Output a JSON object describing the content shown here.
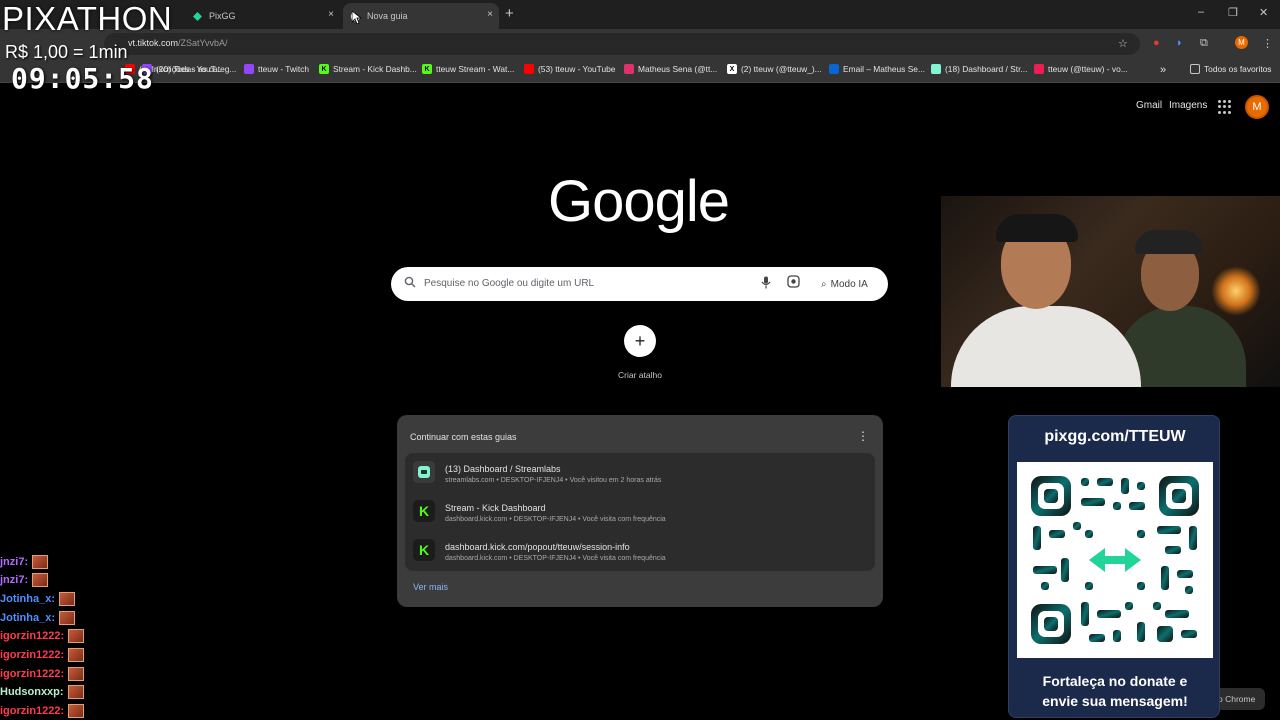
{
  "overlay": {
    "title": "PIXATHON",
    "rate": "R$ 1,00 = 1min",
    "timer": "09:05:58"
  },
  "tabs": [
    {
      "label": "PixGG",
      "active": false,
      "icon": "pixgg-icon",
      "close": "×"
    },
    {
      "label": "Nova guia",
      "active": true,
      "icon": "loading-icon",
      "close": "×"
    }
  ],
  "new_tab_symbol": "+",
  "window_controls": {
    "minimize": "–",
    "restore": "❐",
    "close": "✕"
  },
  "address_bar": {
    "url_host": "vt.tiktok.com",
    "url_path": "/ZSatYvvbA/"
  },
  "bookmarks": {
    "items": [
      {
        "label": "(6) Inscrições - YouT...",
        "icon": "youtube-icon",
        "color": "#ff0000"
      },
      {
        "label": "(20) Todas as categ...",
        "icon": "twitch-icon",
        "color": "#9146ff"
      },
      {
        "label": "tteuw - Twitch",
        "icon": "twitch-icon",
        "color": "#9146ff"
      },
      {
        "label": "Stream - Kick Dashb...",
        "icon": "kick-icon",
        "color": "#53fc18"
      },
      {
        "label": "tteuw Stream - Wat...",
        "icon": "kick-icon",
        "color": "#53fc18"
      },
      {
        "label": "(53) tteuw - YouTube",
        "icon": "youtube-icon",
        "color": "#ff0000"
      },
      {
        "label": "Matheus Sena (@tt...",
        "icon": "instagram-icon",
        "color": "#e1306c"
      },
      {
        "label": "(2) tteuw (@tteuw_)...",
        "icon": "x-icon",
        "color": "#ffffff"
      },
      {
        "label": "Email – Matheus Se...",
        "icon": "outlook-icon",
        "color": "#0a64d6"
      },
      {
        "label": "(18) Dashboard / Str...",
        "icon": "streamlabs-icon",
        "color": "#80f5d2"
      },
      {
        "label": "tteuw (@tteuw) - vo...",
        "icon": "tiktok-icon",
        "color": "#ee1d52"
      }
    ],
    "overflow": "»",
    "all_favorites": "Todos os favoritos"
  },
  "ntp": {
    "gmail": "Gmail",
    "images": "Imagens",
    "avatar_letter": "M",
    "logo": "Google",
    "search_placeholder": "Pesquise no Google ou digite um URL",
    "ai_mode": "Modo IA",
    "shortcut_symbol": "+",
    "shortcut_label": "Criar atalho"
  },
  "continue_card": {
    "title": "Continuar com estas guias",
    "items": [
      {
        "title": "(13) Dashboard / Streamlabs",
        "subtitle": "streamlabs.com • DESKTOP-IFJENJ4 • Você visitou em 2 horas atrás",
        "icon": "streamlabs-icon",
        "color": "#80f5d2"
      },
      {
        "title": "Stream - Kick Dashboard",
        "subtitle": "dashboard.kick.com • DESKTOP-IFJENJ4 • Você visita com frequência",
        "icon": "kick-icon",
        "color": "#53fc18"
      },
      {
        "title": "dashboard.kick.com/popout/tteuw/session-info",
        "subtitle": "dashboard.kick.com • DESKTOP-IFJENJ4 • Você visita com frequência",
        "icon": "kick-icon",
        "color": "#53fc18"
      }
    ],
    "see_more": "Ver mais"
  },
  "customize_button": "o Chrome",
  "donation": {
    "url": "pixgg.com/TTEUW",
    "message_line1": "Fortaleça no donate e",
    "message_line2": "envie sua mensagem!"
  },
  "chat": [
    {
      "user": "jnzi7:",
      "color": "#b06cff"
    },
    {
      "user": "jnzi7:",
      "color": "#b06cff"
    },
    {
      "user": "Jotinha_x:",
      "color": "#4f8fff"
    },
    {
      "user": "Jotinha_x:",
      "color": "#4f8fff"
    },
    {
      "user": "igorzin1222:",
      "color": "#ff3b4f"
    },
    {
      "user": "igorzin1222:",
      "color": "#ff3b4f"
    },
    {
      "user": "igorzin1222:",
      "color": "#ff3b4f"
    },
    {
      "user": "Hudsonxxp:",
      "color": "#b8f0c8"
    },
    {
      "user": "igorzin1222:",
      "color": "#ff3b4f"
    }
  ]
}
